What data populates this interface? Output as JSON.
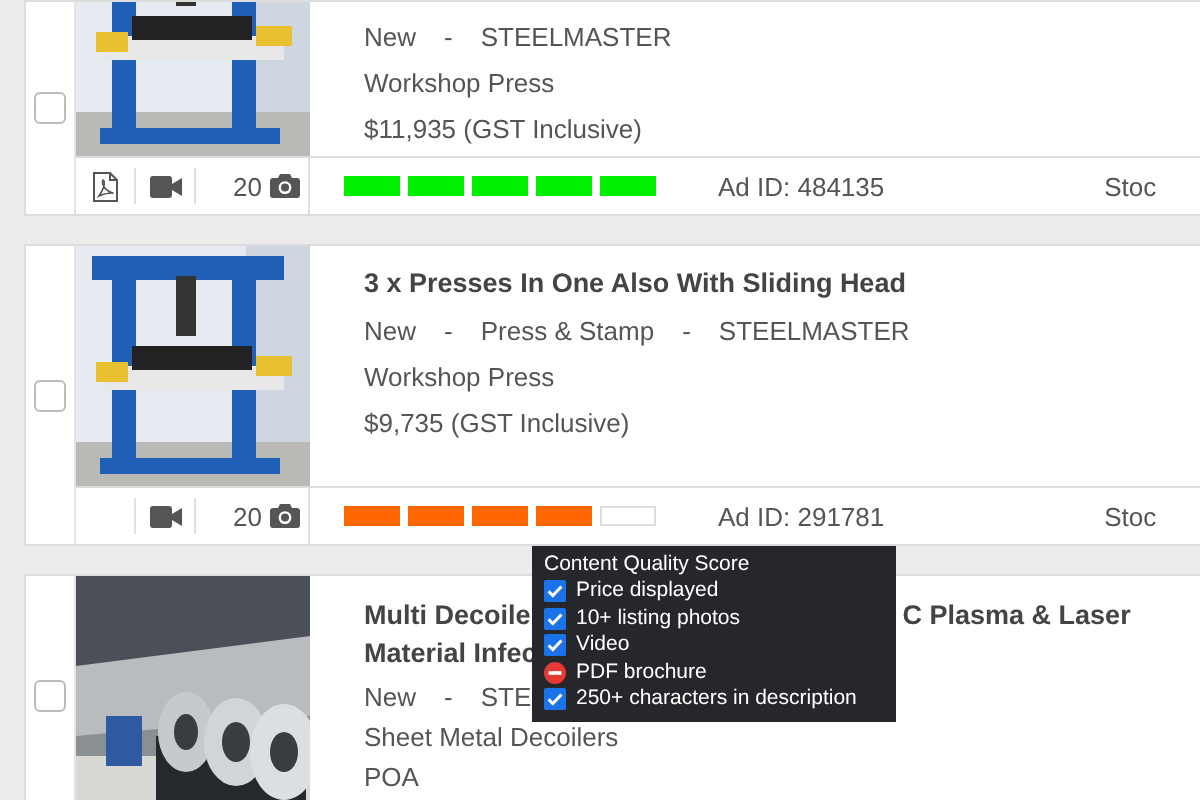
{
  "listings": [
    {
      "selected": false,
      "meta": [
        "New",
        "-",
        "STEELMASTER"
      ],
      "category": "Workshop Press",
      "price": "$11,935 (GST Inclusive)",
      "pdf": true,
      "video": true,
      "photo_count": "20",
      "score": {
        "level": 1,
        "color": "#00ee00"
      },
      "ad_id": "Ad ID: 484135",
      "stock": "Stoc"
    },
    {
      "selected": false,
      "title_lines": [
        [
          "3 x Presses In One Also With Sliding Head"
        ]
      ],
      "meta": [
        "New",
        "-",
        "Press & Stamp",
        "-",
        "STEELMASTER"
      ],
      "category": "Workshop Press",
      "price": "$9,735 (GST Inclusive)",
      "pdf": false,
      "video": true,
      "photo_count": "20",
      "score": {
        "level": 0.8,
        "color": "#ff6600"
      },
      "ad_id": "Ad ID: 291781",
      "stock": "Stoc"
    },
    {
      "selected": false,
      "title_lines": [
        [
          "Multi Decoile",
          "C Plasma & Laser"
        ],
        [
          "Material Infec"
        ]
      ],
      "meta": [
        "New",
        "-",
        "STE"
      ],
      "category": "Sheet Metal Decoilers",
      "price": "POA"
    }
  ],
  "tooltip": {
    "title": "Content Quality Score",
    "items": [
      {
        "label": "Price displayed",
        "passed": true
      },
      {
        "label": "10+ listing photos",
        "passed": true
      },
      {
        "label": "Video",
        "passed": true
      },
      {
        "label": "PDF brochure",
        "passed": false
      },
      {
        "label": "250+ characters in description",
        "passed": true
      }
    ]
  }
}
